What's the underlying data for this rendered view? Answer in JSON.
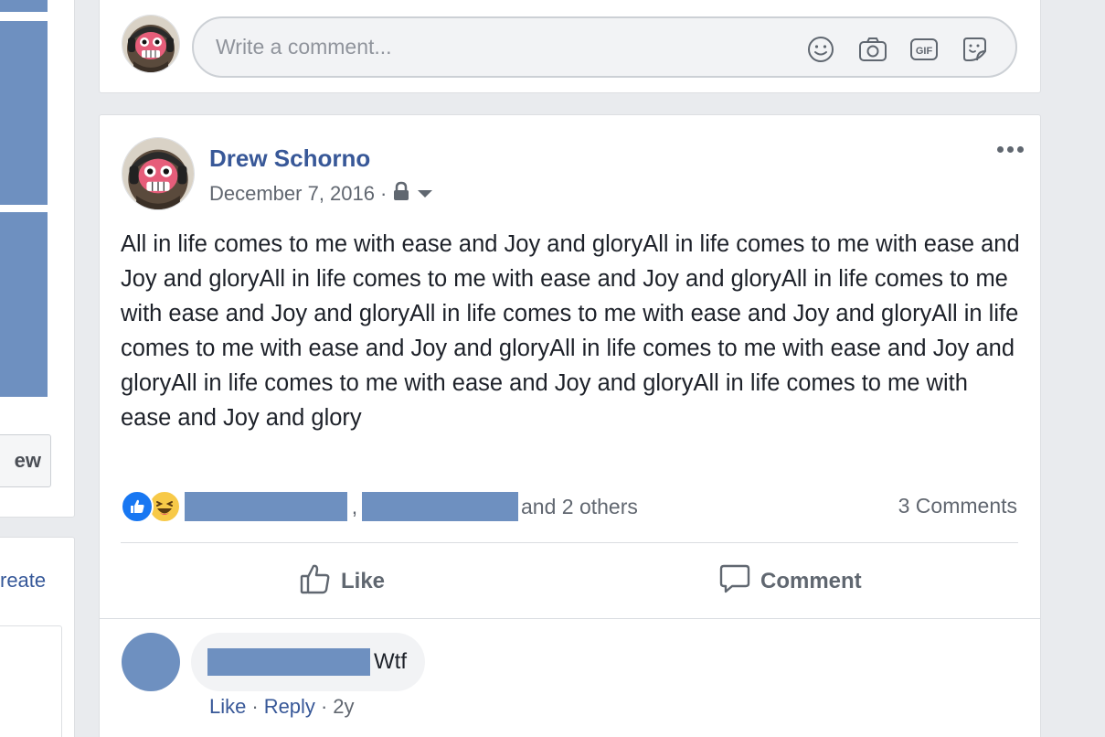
{
  "left_column": {
    "view_button_label": "ew",
    "create_link": "reate"
  },
  "comment_composer": {
    "placeholder": "Write a comment...",
    "icons": [
      "emoji-icon",
      "camera-icon",
      "gif-icon",
      "sticker-icon"
    ],
    "gif_label": "GIF"
  },
  "post": {
    "author": "Drew Schorno",
    "date": "December 7, 2016",
    "separator": "·",
    "privacy_icon": "lock-icon",
    "body": "All in life comes to me with ease and Joy and gloryAll in life comes to me with ease and Joy and gloryAll in life comes to me with ease and Joy and gloryAll in life comes to me with ease and Joy and gloryAll in life comes to me with ease and Joy and gloryAll in life comes to me with ease and Joy and gloryAll in life comes to me with ease and Joy and gloryAll in life comes to me with ease and Joy and gloryAll in life comes to me with ease and Joy and glory",
    "reactions": {
      "icons": [
        "like-reaction-icon",
        "haha-reaction-icon"
      ],
      "comma": ",",
      "others_text": "and 2 others"
    },
    "comments_count_text": "3 Comments",
    "actions": {
      "like_label": "Like",
      "comment_label": "Comment"
    }
  },
  "comments": [
    {
      "text": "Wtf",
      "like_label": "Like",
      "reply_label": "Reply",
      "separator": "·",
      "age": "2y"
    }
  ],
  "colors": {
    "brand_blue": "#385898",
    "redaction_blue": "#6e90c0",
    "background": "#e9ebee",
    "secondary_text": "#616770"
  }
}
